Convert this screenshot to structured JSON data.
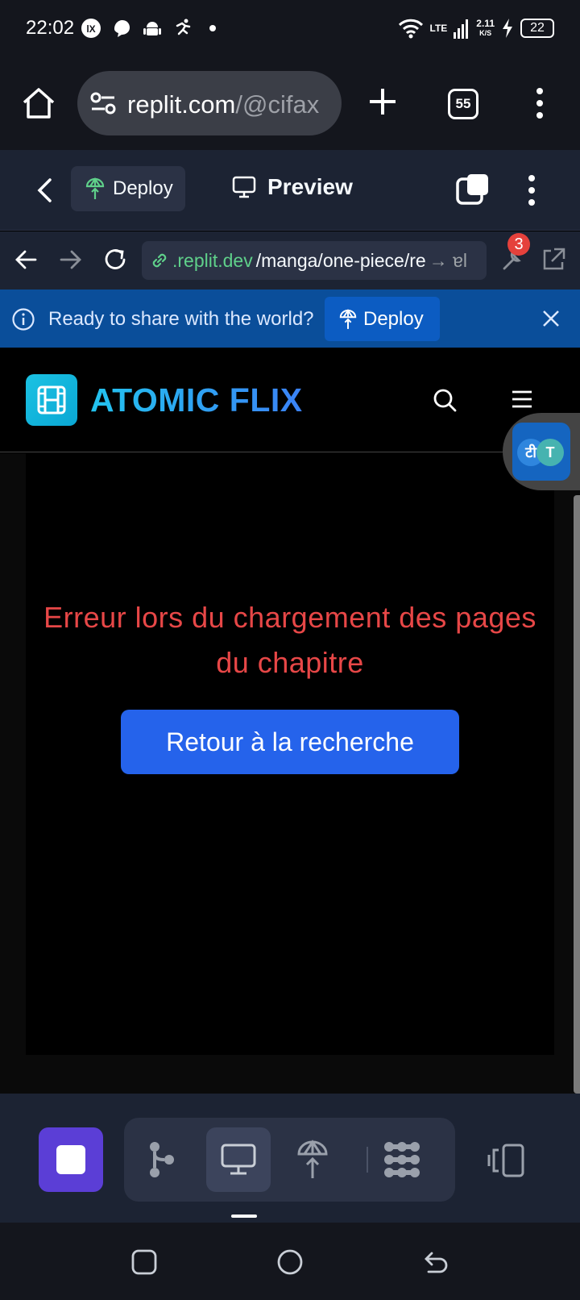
{
  "status_bar": {
    "time": "22:02",
    "network": "LTE",
    "speed_value": "2.11",
    "speed_unit": "K/S",
    "battery": "22",
    "icons": [
      "notification-app-icon",
      "messenger-icon",
      "android-icon",
      "activity-icon",
      "wifi-icon",
      "signal-icon",
      "charging-icon"
    ]
  },
  "browser": {
    "url_host": "replit.com",
    "url_path": "/@cifax",
    "tab_count": "55"
  },
  "replit_header": {
    "deploy_label": "Deploy",
    "preview_label": "Preview"
  },
  "webview_nav": {
    "url_domain": ".replit.dev",
    "url_path": "/manga/one-piece/re",
    "url_tail": "→ ɐl",
    "devtools_badge": "3"
  },
  "banner": {
    "message": "Ready to share with the world?",
    "deploy_label": "Deploy"
  },
  "site": {
    "brand": "ATOMIC FLIX",
    "translate_glyph_1": "टी",
    "translate_glyph_2": "T",
    "error_message": "Erreur lors du chargement des pages du chapitre",
    "back_button": "Retour à la recherche"
  },
  "bottom_tools": {
    "items": [
      "stop-icon",
      "git-icon",
      "preview-icon",
      "deploy-icon",
      "workspace-icon",
      "devices-icon"
    ],
    "active": "preview-icon"
  },
  "colors": {
    "accent_blue": "#2563eb",
    "error_red": "#e74747",
    "banner_blue": "#0a4e9a",
    "replit_bg": "#1c2333",
    "stop_purple": "#5b3ed6"
  }
}
